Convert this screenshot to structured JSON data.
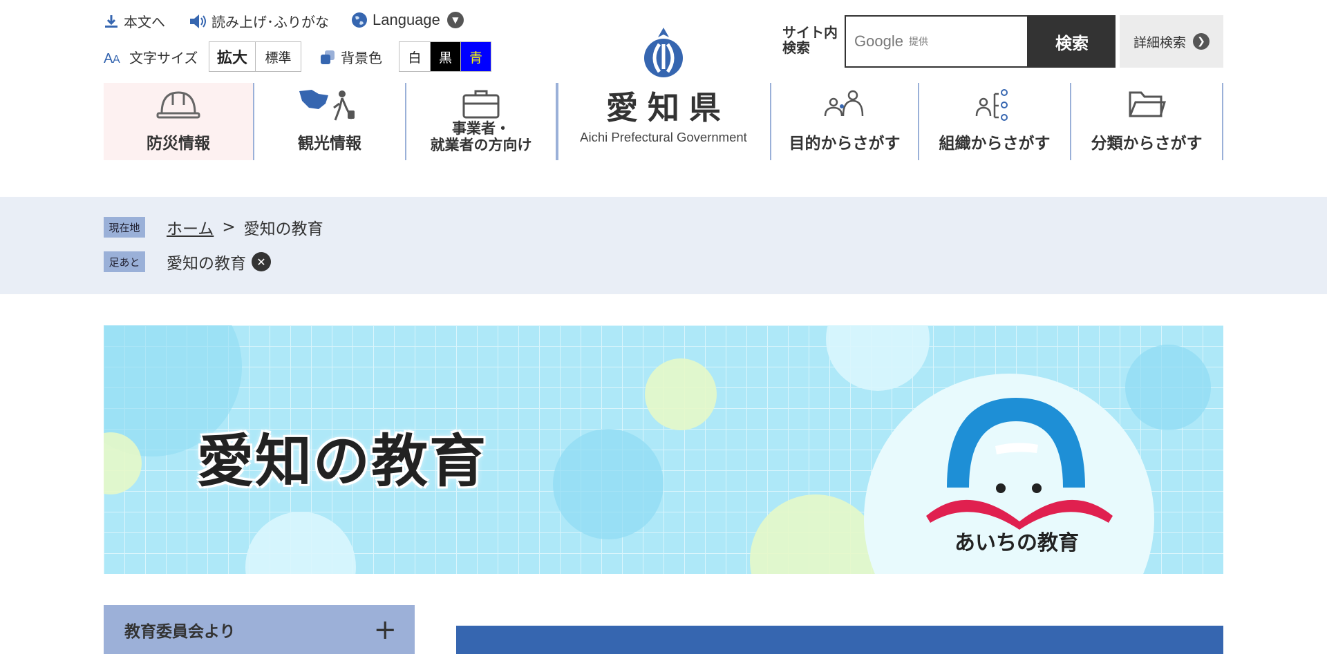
{
  "util": {
    "skip_label": "本文へ",
    "reader_label": "読み上げ･ふりがな",
    "language_label": "Language",
    "font_size_label": "文字サイズ",
    "font_size_options": [
      "拡大",
      "標準"
    ],
    "bg_color_label": "背景色",
    "bg_color_options": [
      "白",
      "黒",
      "青"
    ]
  },
  "logo": {
    "title": "愛知県",
    "subtitle": "Aichi Prefectural Government"
  },
  "search": {
    "label": "サイト内\n検索",
    "placeholder_brand": "Google",
    "placeholder_note": "提供",
    "button": "検索",
    "advanced": "詳細検索"
  },
  "nav": {
    "items": [
      {
        "label": "防災情報",
        "icon": "helmet-icon"
      },
      {
        "label": "観光情報",
        "icon": "tourist-icon"
      },
      {
        "label": "事業者・\n就業者の方向け",
        "icon": "briefcase-icon"
      },
      {
        "label": "目的からさがす",
        "icon": "people-icon"
      },
      {
        "label": "組織からさがす",
        "icon": "organization-icon"
      },
      {
        "label": "分類からさがす",
        "icon": "folder-icon"
      }
    ]
  },
  "breadcrumb": {
    "current_tag": "現在地",
    "home": "ホーム",
    "separator": ">",
    "current": "愛知の教育",
    "history_tag": "足あと",
    "history_item": "愛知の教育"
  },
  "banner": {
    "title": "愛知の教育",
    "logo_text": "あいちの教育"
  },
  "side_menu": {
    "label": "教育委員会より",
    "toggle": "+"
  },
  "colors": {
    "accent": "#3666b0",
    "nav_divider": "#9ab0d8",
    "crumb_bg": "#e9eef6",
    "side_menu_bg": "#9cb0d8",
    "banner_bg": "#aee8f8"
  }
}
